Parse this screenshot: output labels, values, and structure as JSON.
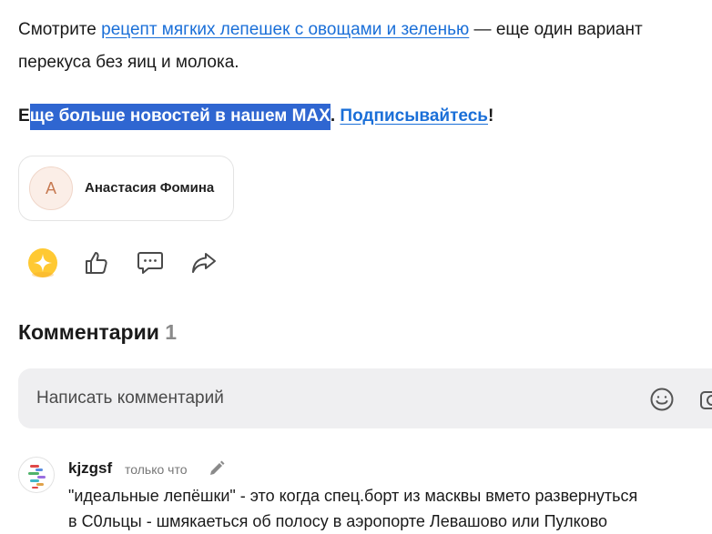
{
  "article": {
    "para1_prefix": "Смотрите ",
    "para1_link": "рецепт мягких лепешек с овощами и зеленью",
    "para1_suffix": " — еще один вариант",
    "para1_line2": "перекуса без яиц и молока.",
    "para2_first": "Е",
    "para2_selected": "ще больше новостей в нашем MAX",
    "para2_dot": ". ",
    "para2_link": "Подписывайтесь",
    "para2_end": "!"
  },
  "author": {
    "initial": "А",
    "name": "Анастасия Фомина"
  },
  "actions": {
    "icons": [
      "sparkle-reaction-icon",
      "thumbs-up-icon",
      "comment-icon",
      "share-icon"
    ]
  },
  "comments": {
    "title": "Комментарии",
    "count": "1",
    "input_placeholder": "Написать комментарий",
    "items": [
      {
        "author": "kjzgsf",
        "time": "только что",
        "line1": "\"идеальные лепёшки\" - это когда спец.борт из масквы вмето развернуться",
        "line2": "в С0льцы - шмякаеться об полосу в аэропорте Левашово или Пулково"
      }
    ]
  },
  "colors": {
    "link": "#1a6fd8",
    "selection": "#2f66d1",
    "reaction_yellow": "#ffc933"
  }
}
